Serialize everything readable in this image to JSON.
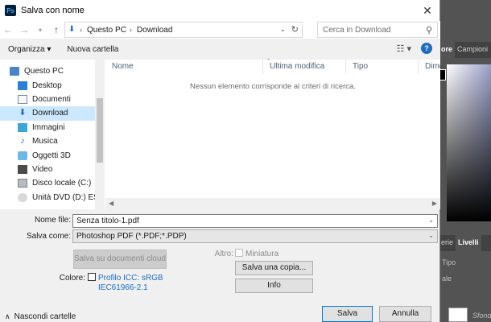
{
  "dialog": {
    "title": "Salva con nome",
    "app_icon": "Ps",
    "close": "✕"
  },
  "address": {
    "crumbs": [
      "Questo PC",
      "Download"
    ],
    "search_placeholder": "Cerca in Download"
  },
  "toolbar": {
    "organize": "Organizza ▾",
    "new_folder": "Nuova cartella"
  },
  "nav": {
    "items": [
      {
        "label": "Questo PC",
        "icon": "pc-icon"
      },
      {
        "label": "Desktop",
        "icon": "desktop-icon"
      },
      {
        "label": "Documenti",
        "icon": "documents-icon"
      },
      {
        "label": "Download",
        "icon": "download-icon",
        "selected": true
      },
      {
        "label": "Immagini",
        "icon": "pictures-icon"
      },
      {
        "label": "Musica",
        "icon": "music-icon"
      },
      {
        "label": "Oggetti 3D",
        "icon": "objects-3d-icon"
      },
      {
        "label": "Video",
        "icon": "video-icon"
      },
      {
        "label": "Disco locale (C:)",
        "icon": "disk-icon"
      },
      {
        "label": "Unità DVD (D:) ESD-I",
        "icon": "dvd-icon"
      }
    ]
  },
  "list": {
    "columns": [
      "Nome",
      "Ultima modifica",
      "Tipo",
      "Dime"
    ],
    "empty_message": "Nessun elemento corrisponde ai criteri di ricerca."
  },
  "form": {
    "filename_label": "Nome file:",
    "filename_value": "Senza titolo-1.pdf",
    "saveas_label": "Salva come:",
    "saveas_value": "Photoshop PDF (*.PDF;*.PDP)",
    "cloud_button": "Salva su documenti cloud",
    "altro_label": "Altro:",
    "miniatura_label": "Miniatura",
    "save_copy_button": "Salva una copia...",
    "info_button": "Info",
    "colors_label": "Colore:",
    "icc_line1": "Profilo ICC:  sRGB",
    "icc_line2": "IEC61966-2.1",
    "hide_folders": "Nascondi cartelle",
    "save_button": "Salva",
    "cancel_button": "Annulla"
  },
  "photoshop": {
    "tabs_top": [
      "ore",
      "Campioni"
    ],
    "tabs_bottom": [
      "erie",
      "Livelli"
    ],
    "row_tipo": "Tipo",
    "row_normale": "ale",
    "row_sfondo": "Sfondo"
  }
}
